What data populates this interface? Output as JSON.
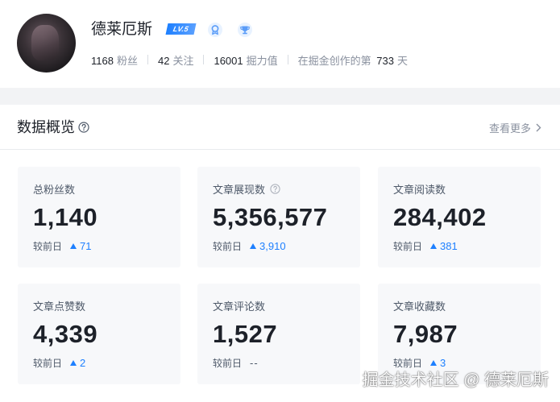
{
  "profile": {
    "name": "德莱厄斯",
    "level_badge": "LV.5",
    "stats": [
      {
        "value": "1168",
        "label": "粉丝"
      },
      {
        "value": "42",
        "label": "关注"
      },
      {
        "value": "16001",
        "label": "掘力值"
      }
    ],
    "days_prefix": "在掘金创作的第",
    "days_value": "733",
    "days_suffix": "天",
    "badge_icons": [
      "medal-icon",
      "trophy-icon"
    ]
  },
  "overview": {
    "title": "数据概览",
    "more_label": "查看更多",
    "tiles": [
      {
        "label": "总粉丝数",
        "value": "1,140",
        "compare_label": "较前日",
        "delta": "71",
        "trend": "up"
      },
      {
        "label": "文章展现数",
        "value": "5,356,577",
        "compare_label": "较前日",
        "delta": "3,910",
        "trend": "up",
        "has_help": true
      },
      {
        "label": "文章阅读数",
        "value": "284,402",
        "compare_label": "较前日",
        "delta": "381",
        "trend": "up"
      },
      {
        "label": "文章点赞数",
        "value": "4,339",
        "compare_label": "较前日",
        "delta": "2",
        "trend": "up"
      },
      {
        "label": "文章评论数",
        "value": "1,527",
        "compare_label": "较前日",
        "delta": "--",
        "trend": "none"
      },
      {
        "label": "文章收藏数",
        "value": "7,987",
        "compare_label": "较前日",
        "delta": "3",
        "trend": "up"
      }
    ]
  },
  "watermark": "掘金技术社区 @ 德莱厄斯",
  "colors": {
    "accent": "#1e80ff",
    "text": "#1d2129",
    "muted": "#8a919f",
    "tile_bg": "#f7f8fa",
    "page_bg": "#f2f3f5"
  }
}
